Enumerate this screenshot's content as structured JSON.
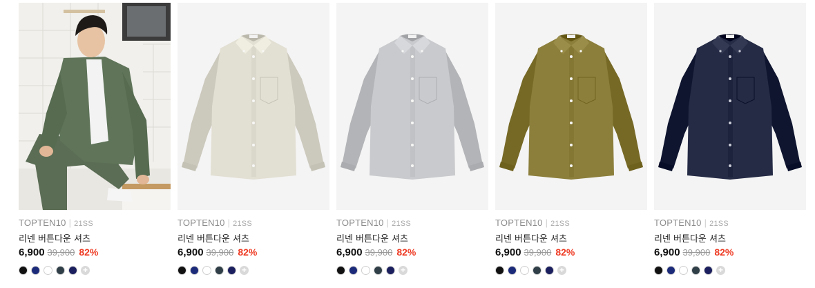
{
  "products": [
    {
      "brand": "TOPTEN10",
      "season": "21SS",
      "name": "리넨 버튼다운 셔츠",
      "price": "6,900",
      "original_price": "39,900",
      "discount": "82%",
      "image": "model-photo",
      "shirt_color": "#5f7459"
    },
    {
      "brand": "TOPTEN10",
      "season": "21SS",
      "name": "리넨 버튼다운 셔츠",
      "price": "6,900",
      "original_price": "39,900",
      "discount": "82%",
      "image": "shirt",
      "shirt_color": "#e2dfd3"
    },
    {
      "brand": "TOPTEN10",
      "season": "21SS",
      "name": "리넨 버튼다운 셔츠",
      "price": "6,900",
      "original_price": "39,900",
      "discount": "82%",
      "image": "shirt",
      "shirt_color": "#c9cacd"
    },
    {
      "brand": "TOPTEN10",
      "season": "21SS",
      "name": "리넨 버튼다운 셔츠",
      "price": "6,900",
      "original_price": "39,900",
      "discount": "82%",
      "image": "shirt",
      "shirt_color": "#8c7f3c"
    },
    {
      "brand": "TOPTEN10",
      "season": "21SS",
      "name": "리넨 버튼다운 셔츠",
      "price": "6,900",
      "original_price": "39,900",
      "discount": "82%",
      "image": "shirt",
      "shirt_color": "#252b45"
    }
  ],
  "swatch_colors": [
    "#111111",
    "#1c2a7a",
    "#ffffff",
    "#2f3e47",
    "#1b1f5e"
  ],
  "more_swatches_icon": "plus-icon",
  "colors": {
    "discount": "#ee3b24",
    "muted": "#8c8c8c",
    "image_bg": "#f4f4f4"
  }
}
